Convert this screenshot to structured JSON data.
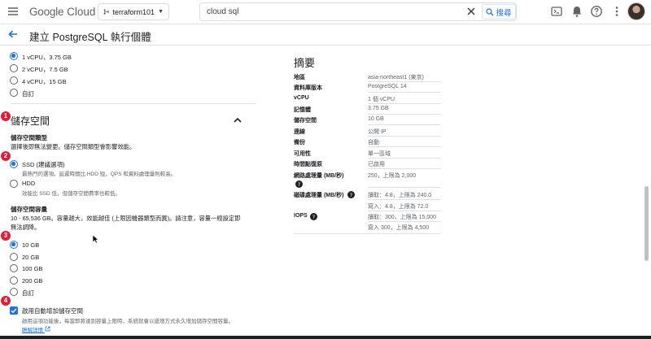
{
  "topbar": {
    "logo_google": "Google",
    "logo_cloud": " Cloud",
    "project": "terraform101",
    "search_value": "cloud sql",
    "search_button": "搜尋"
  },
  "header": {
    "title": "建立 PostgreSQL 執行個體"
  },
  "machine": {
    "options": [
      "1 vCPU，3.75 GB",
      "2 vCPU，7.5 GB",
      "4 vCPU，15 GB",
      "自訂"
    ]
  },
  "storage": {
    "section_title": "儲存空間",
    "type_title": "儲存空間類型",
    "type_desc": "選擇後即無法變更。儲存空間類型會影響效能。",
    "ssd_label": "SSD (建議選項)",
    "ssd_desc": "最熱門的選項。延遲時間比 HDD 短，QPS 和資料處理量則較高。",
    "hdd_label": "HDD",
    "hdd_desc": "效能比 SSD 低，但儲存空間費率也較低。",
    "capacity_title": "儲存空間容量",
    "capacity_desc_1": "10 - 65,536 GB。容量越大，效能越佳 (上限因機器類型而異)。請注意，容量一經設定即",
    "capacity_desc_2": "無法調降。",
    "capacity_options": [
      "10 GB",
      "20 GB",
      "100 GB",
      "200 GB",
      "自訂"
    ],
    "auto_label": "啟用自動增加儲存空間",
    "auto_desc": "啟用這項功能後，每當即將達到容量上限時，系統就會以遞增方式永久增加儲存空間容量。",
    "learn_more": "瞭解詳情"
  },
  "badges": [
    "1",
    "2",
    "3",
    "4"
  ],
  "summary": {
    "title": "摘要",
    "rows": [
      {
        "key": "地區",
        "value": "asia-northeast1 (東京)"
      },
      {
        "key": "資料庫版本",
        "value": "PostgreSQL 14"
      },
      {
        "key": "vCPU",
        "value": "1 個 vCPU"
      },
      {
        "key": "記憶體",
        "value": "3.75 GB"
      },
      {
        "key": "儲存空間",
        "value": "10 GB"
      },
      {
        "key": "連線",
        "value": "公開 IP"
      },
      {
        "key": "備份",
        "value": "自動"
      },
      {
        "key": "可用性",
        "value": "單一區域"
      },
      {
        "key": "時間點復原",
        "value": "已啟用"
      },
      {
        "key": "網路處理量 (MB/秒)",
        "value": "250，上限為 2,000"
      }
    ],
    "disk_key": "磁碟處理量 (MB/秒)",
    "disk_values": [
      "讀取：4.8，上限為 240.0",
      "寫入：4.8，上限為 72.0"
    ],
    "iops_key": "IOPS",
    "iops_values": [
      "讀取：300，上限為 15,000",
      "寫入 300，上限為 4,500"
    ]
  },
  "colors": {
    "accent": "#1a73e8",
    "badge": "#e21d37"
  }
}
